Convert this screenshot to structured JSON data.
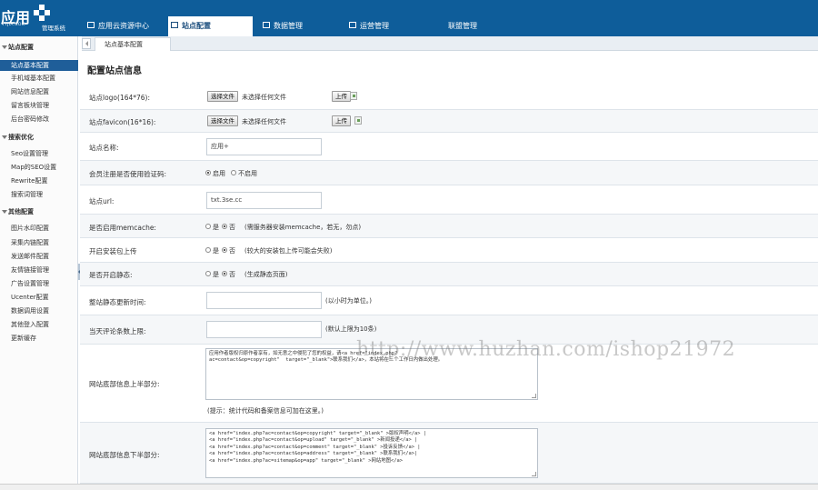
{
  "logo": {
    "brand": "应用",
    "sub": "YYJIA.COM",
    "system": "管理系统"
  },
  "nav": [
    {
      "label": "应用云资源中心",
      "icon": "upload-icon"
    },
    {
      "label": "站点配置",
      "icon": "home-icon"
    },
    {
      "label": "数据管理",
      "icon": "list-icon"
    },
    {
      "label": "运营管理",
      "icon": "users-icon"
    },
    {
      "label": "联盟管理",
      "icon": ""
    }
  ],
  "sidebar": {
    "groups": [
      {
        "title": "站点配置",
        "items": [
          "站点基本配置",
          "手机域基本配置",
          "网站信息配置",
          "留言板块管理",
          "后台密码修改"
        ]
      },
      {
        "title": "搜索优化",
        "items": [
          "Seo设置管理",
          "Map的SEO设置",
          "Rewrite配置",
          "搜索词管理"
        ]
      },
      {
        "title": "其他配置",
        "items": [
          "图片水印配置",
          "采集内链配置",
          "发送邮件配置",
          "友情链接管理",
          "广告设置管理",
          "Ucenter配置",
          "数据调用设置",
          "其他登入配置",
          "更新缓存"
        ]
      }
    ],
    "active_item": "站点基本配置"
  },
  "tabs": {
    "current": "站点基本配置"
  },
  "page": {
    "title": "配置站点信息"
  },
  "form": {
    "logo": {
      "label": "站点logo(164*76):",
      "choose": "选择文件",
      "no_file": "未选择任何文件",
      "upload": "上传"
    },
    "favicon": {
      "label": "站点favicon(16*16):",
      "choose": "选择文件",
      "no_file": "未选择任何文件",
      "upload": "上传"
    },
    "site_name": {
      "label": "站点名称:",
      "value": "应用+"
    },
    "captcha": {
      "label": "会员注册是否使用验证码:",
      "opt_on": "启用",
      "opt_off": "不启用",
      "selected": "启用"
    },
    "site_url": {
      "label": "站点url:",
      "value": "txt.3se.cc"
    },
    "memcache": {
      "label": "是否启用memcache:",
      "opt_yes": "是",
      "opt_no": "否",
      "selected": "否",
      "hint": "(需服务器安装memcache，若无，勿点)"
    },
    "pkg_upload": {
      "label": "开启安装包上传",
      "opt_yes": "是",
      "opt_no": "否",
      "selected": "否",
      "hint": "(较大的安装包上传可能会失败)"
    },
    "static": {
      "label": "是否开启静态:",
      "opt_yes": "是",
      "opt_no": "否",
      "selected": "否",
      "hint": "(生成静态页面)"
    },
    "static_update": {
      "label": "整站静态更新时间:",
      "value": "",
      "hint": "(以小时为单位。)"
    },
    "comment_limit": {
      "label": "当天评论条数上限:",
      "value": "",
      "hint": "(默认上限为10条)"
    },
    "footer_top": {
      "label": "网站底部信息上半部分:",
      "text": "应用作者版权归原作者享有，如无意之中侵犯了您的权益，请<a href=\"index.php?\nac=contact&op=copyright\"  target=\"_blank\">联系我们</a>，本站将在三个工作日内做出处理。",
      "hint": "(提示：统计代码和备案信息可加在这里。)"
    },
    "footer_bottom": {
      "label": "网站底部信息下半部分:",
      "text": "<a href=\"index.php?ac=contact&op=copyright\" target=\"_blank\" >版权声明</a> |\n<a href=\"index.php?ac=contact&op=upload\" target=\"_blank\" >新闻投递</a> |\n<a href=\"index.php?ac=contact&op=comment\" target=\"_blank\" >投诉反馈</a> |\n<a href=\"index.php?ac=contact&op=address\" target=\"_blank\" >联系我们</a>|\n<a href=\"index.php?ac=sitemap&op=app\" target=\"_blank\" >网站地图</a>"
    }
  },
  "watermark": "http://www.huzhan.com/ishop21972",
  "colors": {
    "topbar": "#0e5d9a",
    "active_sidebar": "#1f5e99"
  }
}
